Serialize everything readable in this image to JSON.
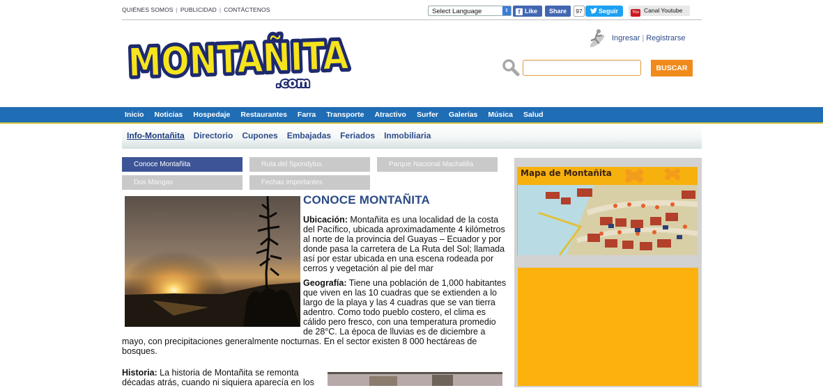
{
  "top_links": [
    "QUIÉNES SOMOS",
    "PUBLICIDAD",
    "CONTÁCTENOS"
  ],
  "language_select": {
    "value": "Select Language"
  },
  "social": {
    "fb_like": "Like",
    "fb_share": "Share",
    "twitter_count": "97",
    "twitter_follow": "Seguir",
    "youtube": "Canal Youtube",
    "youtube_icon_text": "You"
  },
  "logo": {
    "text": "MONTAÑITA",
    "sub": ".com"
  },
  "auth": {
    "login": "Ingresar",
    "register": "Registrarse"
  },
  "search": {
    "value": "",
    "button": "BUSCAR"
  },
  "main_nav": [
    "Inicio",
    "Noticias",
    "Hospedaje",
    "Restaurantes",
    "Farra",
    "Transporte",
    "Atractivo",
    "Surfer",
    "Galerías",
    "Música",
    "Salud"
  ],
  "sub_nav": [
    "Info-Montañita",
    "Directorio",
    "Cupones",
    "Embajadas",
    "Feriados",
    "Inmobiliaria"
  ],
  "tabs": [
    "Conoce Montañita",
    "Ruta del Spondylus",
    "Parque Nacional Machalilla",
    "Dos Mangas",
    "Fechas importantes"
  ],
  "article": {
    "title": "CONOCE MONTAÑITA",
    "ubicacion_label": "Ubicación:",
    "ubicacion_text": " Montañita es una localidad de la costa del Pacífico, ubicada aproximadamente 4 kilómetros al norte de la provincia del Guayas – Ecuador y por donde pasa la carretera de La Ruta del Sol; llamada así por estar ubicada en una escena rodeada por cerros y vegetación al pie del mar",
    "geografia_label": "Geografía:",
    "geografia_text": " Tiene una población de 1,000 habitantes que viven en las 10 cuadras que se extienden a lo largo de la playa y las 4 cuadras que se van tierra adentro. Como todo pueblo costero, el clima es cálido pero fresco, con una temperatura promedio de 28°C. La época de lluvias es de diciembre a mayo, con precipitaciones generalmente nocturnas. En el sector existen 8 000 hectáreas de bosques.",
    "historia_label": "Historia:",
    "historia_text": " La historia de Montañita se remonta décadas atrás, cuando ni siquiera aparecía en los"
  },
  "sidebar": {
    "map_title": "Mapa de Montañita"
  },
  "colors": {
    "nav_blue": "#1f6db5",
    "accent_orange": "#f08a1b",
    "title_blue": "#2b4a86",
    "sidebar_yellow": "#f6b10f"
  },
  "icons": [
    "search-icon",
    "surfer-login-icon",
    "facebook-icon",
    "twitter-icon",
    "youtube-icon"
  ]
}
